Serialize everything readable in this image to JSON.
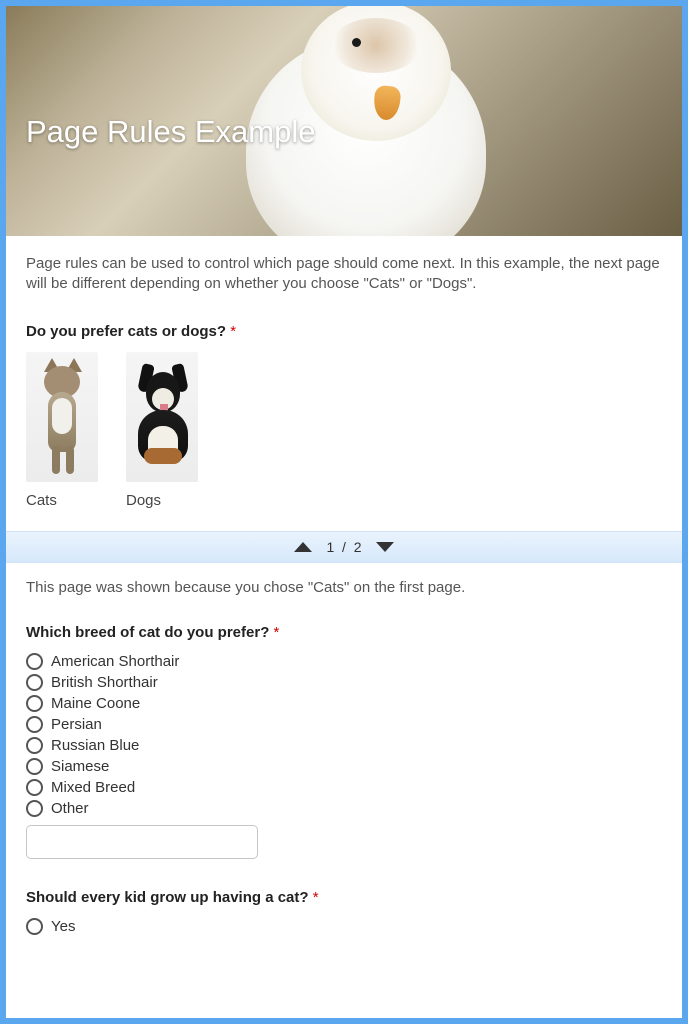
{
  "header": {
    "title": "Page Rules Example"
  },
  "page1": {
    "intro": "Page rules can be used to control which page should come next. In this example, the next page will be different depending on whether you choose \"Cats\" or \"Dogs\".",
    "q1_label": "Do you prefer cats or dogs?",
    "required_mark": "*",
    "options": [
      {
        "label": "Cats"
      },
      {
        "label": "Dogs"
      }
    ]
  },
  "pager": {
    "current": "1",
    "sep": "/",
    "total": "2"
  },
  "page2": {
    "explain": "This page was shown because you chose \"Cats\" on the first page.",
    "q2_label": "Which breed of cat do you prefer?",
    "required_mark": "*",
    "q2_options": [
      "American Shorthair",
      "British Shorthair",
      "Maine Coone",
      "Persian",
      "Russian Blue",
      "Siamese",
      "Mixed Breed",
      "Other"
    ],
    "q3_label": "Should every kid grow up having a cat?",
    "q3_options": [
      "Yes"
    ]
  }
}
